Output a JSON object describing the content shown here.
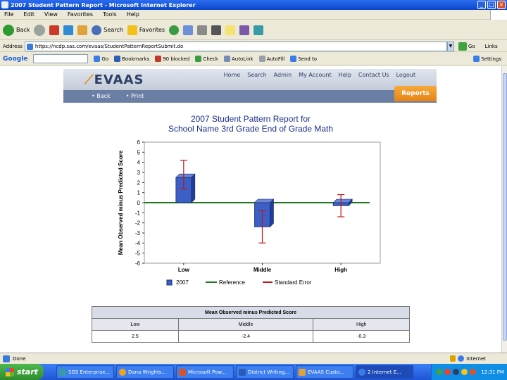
{
  "window": {
    "title": "2007 Student Pattern Report - Microsoft Internet Explorer"
  },
  "menu": [
    "File",
    "Edit",
    "View",
    "Favorites",
    "Tools",
    "Help"
  ],
  "toolbar": {
    "back": "Back",
    "search": "Search",
    "favorites": "Favorites"
  },
  "address": {
    "label": "Address",
    "url": "https://ncdp.sas.com/evaas/StudentPatternReportSubmit.do",
    "go": "Go",
    "links": "Links"
  },
  "google": {
    "logo": "Google",
    "go": "Go",
    "bookmarks": "Bookmarks",
    "blocked": "90 blocked",
    "check": "Check",
    "autolink": "AutoLink",
    "autofill": "AutoFill",
    "sendto": "Send to",
    "settings": "Settings"
  },
  "evaas": {
    "logo": "EVAAS",
    "nav": [
      "Home",
      "Search",
      "Admin",
      "My Account",
      "Help",
      "Contact Us",
      "Logout"
    ],
    "back": "Back",
    "print": "Print",
    "reports": "Reports"
  },
  "chart_data": {
    "type": "bar",
    "title": "2007 Student Pattern Report for",
    "subtitle": "School Name 3rd Grade End of Grade Math",
    "ylabel": "Mean Observed minus Predicted Score",
    "xlabel": "",
    "ylim": [
      -6,
      6
    ],
    "yticks": [
      6,
      5,
      4,
      3,
      2,
      1,
      0,
      -1,
      -2,
      -3,
      -4,
      -5,
      -6
    ],
    "categories": [
      "Low",
      "Middle",
      "High"
    ],
    "series": [
      {
        "name": "2007",
        "values": [
          2.5,
          -2.4,
          -0.3
        ],
        "color": "#3b5fc4"
      }
    ],
    "reference": {
      "name": "Reference",
      "value": 0,
      "color": "#1e7a1e"
    },
    "error_bars": {
      "name": "Standard Error",
      "low": [
        1.4,
        -4.0,
        -1.4
      ],
      "high": [
        4.2,
        -0.8,
        0.8
      ],
      "color": "#c01818"
    },
    "grid": false,
    "legend": "bottom"
  },
  "table": {
    "header": "Mean Observed minus Predicted Score",
    "columns": [
      "Low",
      "Middle",
      "High"
    ],
    "values": [
      "2.5",
      "-2.4",
      "-0.3"
    ]
  },
  "status": {
    "text": "Done",
    "zone": "Internet"
  },
  "taskbar": {
    "start": "start",
    "tasks": [
      "SGS Enterprise...",
      "Dana Wrights...",
      "Microsoft Pow...",
      "District Writing...",
      "EVAAS Custo...",
      "2 Internet E..."
    ],
    "clock": "12:31 PM"
  }
}
